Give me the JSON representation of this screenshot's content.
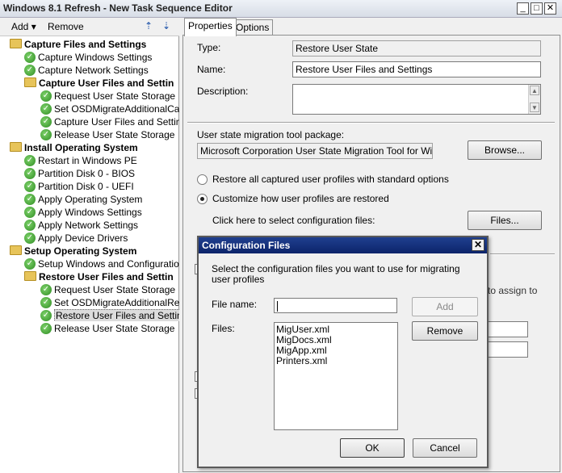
{
  "window": {
    "title": "Windows 8.1 Refresh - New Task Sequence Editor",
    "min": "_",
    "max": "□",
    "close": "✕"
  },
  "toolbar": {
    "add": "Add",
    "remove": "Remove"
  },
  "tree": [
    {
      "label": "Capture Files and Settings",
      "type": "group",
      "level": 0
    },
    {
      "label": "Capture Windows Settings",
      "type": "step",
      "level": 1
    },
    {
      "label": "Capture Network Settings",
      "type": "step",
      "level": 1
    },
    {
      "label": "Capture User Files and Settin",
      "type": "group",
      "level": 1
    },
    {
      "label": "Request User State Storage",
      "type": "step",
      "level": 2
    },
    {
      "label": "Set OSDMigrateAdditionalCapt",
      "type": "step",
      "level": 2
    },
    {
      "label": "Capture User Files and Setting",
      "type": "step",
      "level": 2
    },
    {
      "label": "Release User State Storage",
      "type": "step",
      "level": 2
    },
    {
      "label": "Install Operating System",
      "type": "group",
      "level": 0
    },
    {
      "label": "Restart in Windows PE",
      "type": "step",
      "level": 1
    },
    {
      "label": "Partition Disk 0 - BIOS",
      "type": "step",
      "level": 1
    },
    {
      "label": "Partition Disk 0 - UEFI",
      "type": "step",
      "level": 1
    },
    {
      "label": "Apply Operating System",
      "type": "step",
      "level": 1
    },
    {
      "label": "Apply Windows Settings",
      "type": "step",
      "level": 1
    },
    {
      "label": "Apply Network Settings",
      "type": "step",
      "level": 1
    },
    {
      "label": "Apply Device Drivers",
      "type": "step",
      "level": 1
    },
    {
      "label": "Setup Operating System",
      "type": "group",
      "level": 0
    },
    {
      "label": "Setup Windows and Configuration",
      "type": "step",
      "level": 1
    },
    {
      "label": "Restore User Files and Settin",
      "type": "group",
      "level": 1
    },
    {
      "label": "Request User State Storage",
      "type": "step",
      "level": 2
    },
    {
      "label": "Set  OSDMigrateAdditionalRes",
      "type": "step",
      "level": 2
    },
    {
      "label": "Restore User Files and Setting",
      "type": "step",
      "level": 2,
      "selected": true
    },
    {
      "label": "Release User State Storage",
      "type": "step",
      "level": 2
    }
  ],
  "tabs": {
    "properties": "Properties",
    "options": "Options"
  },
  "props": {
    "type_label": "Type:",
    "type_value": "Restore User State",
    "name_label": "Name:",
    "name_value": "Restore User Files and Settings",
    "description_label": "Description:",
    "description_value": "",
    "package_label": "User state migration tool package:",
    "package_value": "Microsoft Corporation User State Migration Tool for Windows",
    "browse_button": "Browse...",
    "radio_all": "Restore all captured user profiles with standard options",
    "radio_customize": "Customize how user profiles are restored",
    "click_here": "Click here to select configuration files:",
    "files_button": "Files...",
    "partial_text": "to assign to"
  },
  "dialog": {
    "title": "Configuration Files",
    "close": "✕",
    "instruction": "Select the configuration files you want to use for migrating user profiles",
    "filename_label": "File name:",
    "filename_value": "",
    "add_button": "Add",
    "files_label": "Files:",
    "files": [
      "MigUser.xml",
      "MigDocs.xml",
      "MigApp.xml",
      "Printers.xml"
    ],
    "remove_button": "Remove",
    "ok_button": "OK",
    "cancel_button": "Cancel"
  }
}
